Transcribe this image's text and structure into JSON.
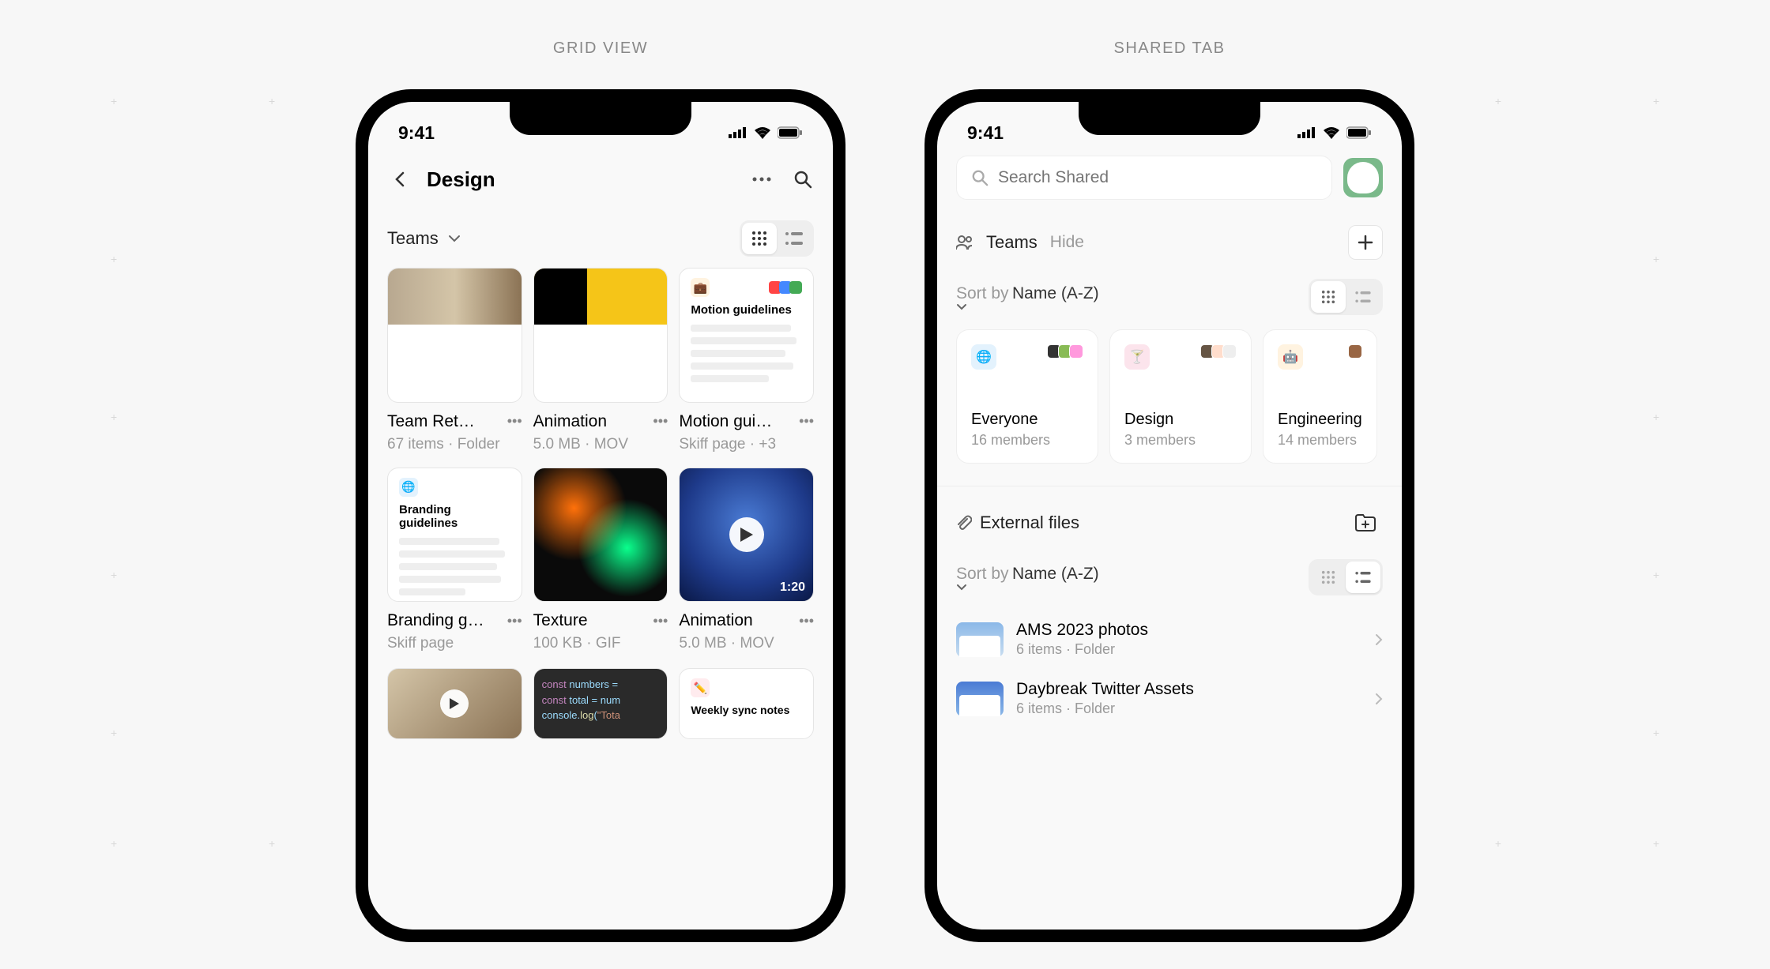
{
  "labels": {
    "grid_view": "GRID VIEW",
    "shared_tab": "SHARED TAB"
  },
  "status": {
    "time": "9:41"
  },
  "gridView": {
    "title": "Design",
    "filter": "Teams",
    "items": [
      {
        "title": "Team Ret…",
        "meta": "67 items · Folder"
      },
      {
        "title": "Animation",
        "meta": "5.0 MB · MOV"
      },
      {
        "title": "Motion gui…",
        "meta": "Skiff page · +3",
        "docTitle": "Motion guidelines"
      },
      {
        "title": "Branding g…",
        "meta": "Skiff page",
        "docTitle": "Branding guidelines"
      },
      {
        "title": "Texture",
        "meta": "100 KB · GIF"
      },
      {
        "title": "Animation",
        "meta": "5.0 MB · MOV",
        "duration": "1:20"
      }
    ],
    "partial": [
      {
        "type": "video"
      },
      {
        "type": "code",
        "l1_kw": "const",
        "l1_rest": " numbers = ",
        "l2_kw": "const",
        "l2_rest": " total = num",
        "l3_a": "console.",
        "l3_fn": "log",
        "l3_b": "(",
        "l3_str": "\"Tota"
      },
      {
        "type": "doc",
        "docTitle": "Weekly sync notes"
      }
    ]
  },
  "sharedTab": {
    "searchPlaceholder": "Search Shared",
    "teamsLabel": "Teams",
    "hideLabel": "Hide",
    "sortLabel": "Sort by",
    "sortValue": "Name (A-Z)",
    "teams": [
      {
        "name": "Everyone",
        "members": "16 members"
      },
      {
        "name": "Design",
        "members": "3 members"
      },
      {
        "name": "Engineering",
        "members": "14 members"
      }
    ],
    "externalLabel": "External files",
    "files": [
      {
        "name": "AMS 2023 photos",
        "meta": "6 items · Folder"
      },
      {
        "name": "Daybreak Twitter Assets",
        "meta": "6 items · Folder"
      }
    ]
  }
}
